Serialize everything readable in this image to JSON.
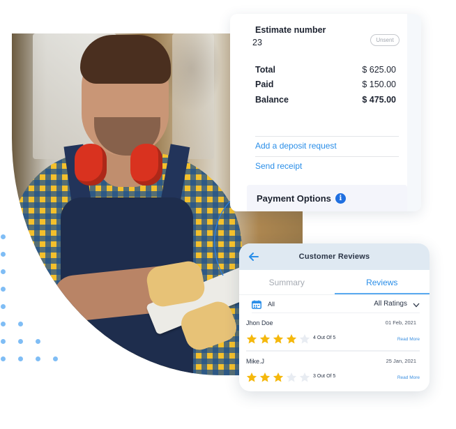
{
  "estimate_card": {
    "estimate_label": "Estimate number",
    "estimate_number": "23",
    "status_badge": "Unsent",
    "rows": [
      {
        "label": "Total",
        "value": "$ 625.00"
      },
      {
        "label": "Paid",
        "value": "$ 150.00"
      },
      {
        "label": "Balance",
        "value": "$ 475.00"
      }
    ],
    "links": {
      "deposit": "Add a deposit request",
      "receipt": "Send receipt"
    },
    "payment_options": {
      "label": "Payment Options",
      "info_icon": "i"
    }
  },
  "reviews_card": {
    "title": "Customer Reviews",
    "back_icon": "arrow-left",
    "tabs": [
      {
        "label": "Summary",
        "active": false
      },
      {
        "label": "Reviews",
        "active": true
      }
    ],
    "filter": {
      "date_icon": "calendar",
      "date_value": "All",
      "rating_value": "All Ratings",
      "rating_icon": "chevron-down"
    },
    "reviews": [
      {
        "name": "Jhon Doe",
        "date": "01 Feb, 2021",
        "rating": 4,
        "max_rating": 5,
        "score_text": "4 Out Of 5",
        "read_more": "Read More"
      },
      {
        "name": "Mike.J",
        "date": "25 Jan, 2021",
        "rating": 3,
        "max_rating": 5,
        "score_text": "3 Out Of 5",
        "read_more": "Read More"
      }
    ]
  },
  "colors": {
    "accent_blue": "#2a8ee8",
    "info_blue": "#1f6fe0",
    "star_filled": "#f5b80c",
    "star_empty": "#e8ecf2",
    "header_bg": "#dfe9f2",
    "dot": "#7fbdf5"
  }
}
